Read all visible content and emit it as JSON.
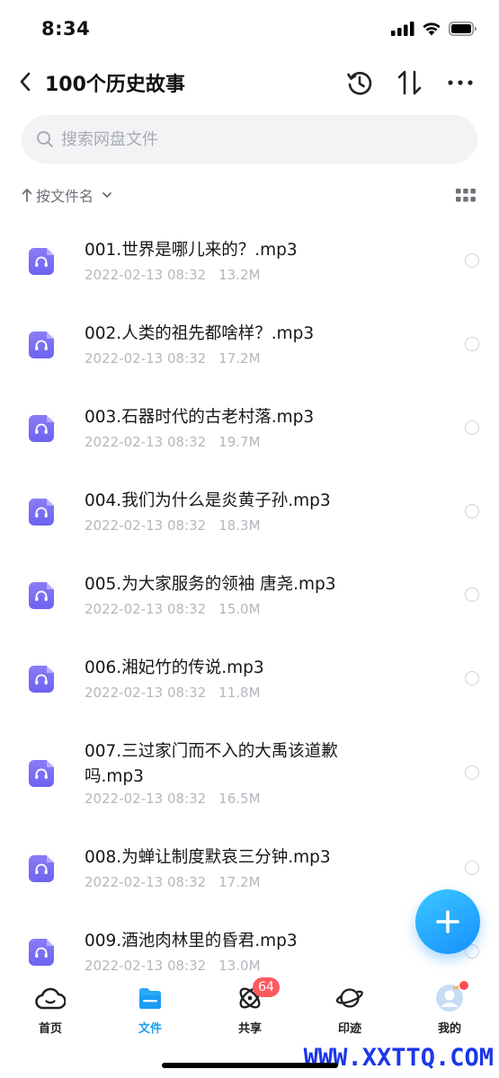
{
  "status_bar": {
    "time": "8:34"
  },
  "header": {
    "title": "100个历史故事"
  },
  "search": {
    "placeholder": "搜索网盘文件"
  },
  "sort": {
    "label": "按文件名"
  },
  "files": [
    {
      "name": "001.世界是哪儿来的？.mp3",
      "date": "2022-02-13 08:32",
      "size": "13.2M"
    },
    {
      "name": "002.人类的祖先都啥样？.mp3",
      "date": "2022-02-13 08:32",
      "size": "17.2M"
    },
    {
      "name": "003.石器时代的古老村落.mp3",
      "date": "2022-02-13 08:32",
      "size": "19.7M"
    },
    {
      "name": "004.我们为什么是炎黄子孙.mp3",
      "date": "2022-02-13 08:32",
      "size": "18.3M"
    },
    {
      "name": "005.为大家服务的领袖 唐尧.mp3",
      "date": "2022-02-13 08:32",
      "size": "15.0M"
    },
    {
      "name": "006.湘妃竹的传说.mp3",
      "date": "2022-02-13 08:32",
      "size": "11.8M"
    },
    {
      "name": "007.三过家门而不入的大禹该道歉吗.mp3",
      "date": "2022-02-13 08:32",
      "size": "16.5M"
    },
    {
      "name": "008.为蝉让制度默哀三分钟.mp3",
      "date": "2022-02-13 08:32",
      "size": "17.2M"
    },
    {
      "name": "009.酒池肉林里的昏君.mp3",
      "date": "2022-02-13 08:32",
      "size": "13.0M"
    }
  ],
  "bottom_nav": {
    "items": [
      {
        "label": "首页",
        "icon": "cloud-icon"
      },
      {
        "label": "文件",
        "icon": "folder-icon",
        "active": true
      },
      {
        "label": "共享",
        "icon": "atom-icon",
        "badge": "64"
      },
      {
        "label": "印迹",
        "icon": "planet-icon"
      },
      {
        "label": "我的",
        "icon": "avatar-icon"
      }
    ]
  },
  "watermark": "WWW.XXTTQ.COM",
  "colors": {
    "accent": "#1b9cf5",
    "file_icon": "#7468f2",
    "badge": "#ff5a5f"
  }
}
